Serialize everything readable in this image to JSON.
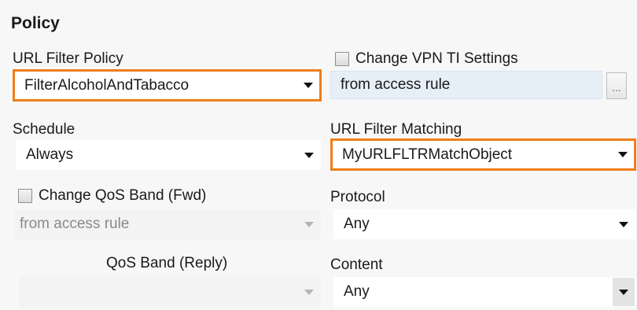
{
  "section_title": "Policy",
  "url_filter_policy": {
    "label": "URL Filter Policy",
    "value": "FilterAlcoholAndTabacco",
    "arrow_icon": "chevron-down-icon"
  },
  "change_vpn_ti": {
    "label": "Change VPN TI Settings",
    "checked": false,
    "value": "from access rule",
    "browse_label": "..."
  },
  "schedule": {
    "label": "Schedule",
    "value": "Always"
  },
  "url_filter_matching": {
    "label": "URL Filter Matching",
    "value": "MyURLFLTRMatchObject"
  },
  "change_qos_fwd": {
    "label": "Change  QoS Band (Fwd)",
    "checked": false,
    "value": "from access rule"
  },
  "protocol": {
    "label": "Protocol",
    "value": "Any"
  },
  "qos_reply": {
    "label": "QoS Band (Reply)",
    "value": ""
  },
  "content": {
    "label": "Content",
    "value": "Any"
  },
  "colors": {
    "highlight": "#f07d1a",
    "readonly_bg": "#e6eef8",
    "disabled_text": "#8a8a8a"
  }
}
